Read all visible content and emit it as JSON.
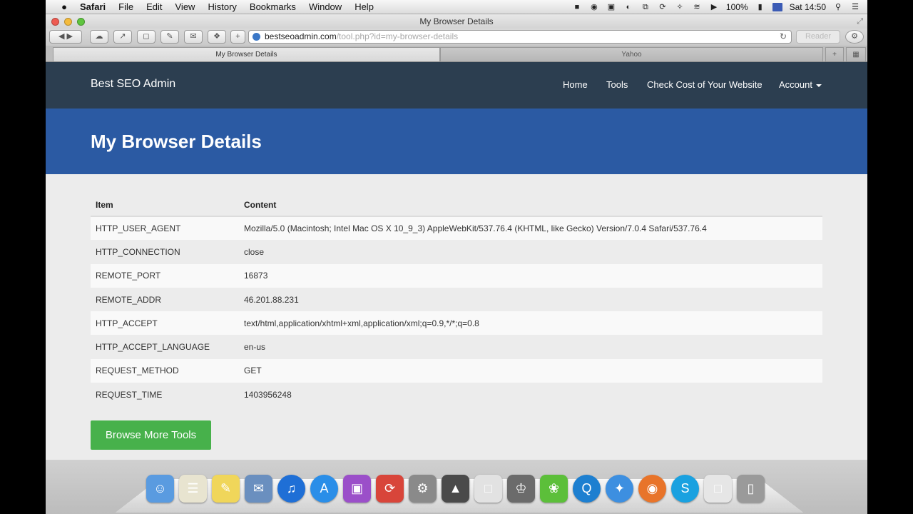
{
  "menubar": {
    "app": "Safari",
    "items": [
      "File",
      "Edit",
      "View",
      "History",
      "Bookmarks",
      "Window",
      "Help"
    ],
    "battery": "100%",
    "clock": "Sat 14:50"
  },
  "window": {
    "title": "My Browser Details",
    "url_host": "bestseoadmin.com",
    "url_path": "/tool.php?id=my-browser-details",
    "reader": "Reader",
    "tabs": [
      "My Browser Details",
      "Yahoo"
    ]
  },
  "site": {
    "brand": "Best SEO Admin",
    "nav": [
      "Home",
      "Tools",
      "Check Cost of Your Website",
      "Account"
    ],
    "hero_title": "My Browser Details",
    "table": {
      "headers": [
        "Item",
        "Content"
      ],
      "rows": [
        [
          "HTTP_USER_AGENT",
          "Mozilla/5.0 (Macintosh; Intel Mac OS X 10_9_3) AppleWebKit/537.76.4 (KHTML, like Gecko) Version/7.0.4 Safari/537.76.4"
        ],
        [
          "HTTP_CONNECTION",
          "close"
        ],
        [
          "REMOTE_PORT",
          "16873"
        ],
        [
          "REMOTE_ADDR",
          "46.201.88.231"
        ],
        [
          "HTTP_ACCEPT",
          "text/html,application/xhtml+xml,application/xml;q=0.9,*/*;q=0.8"
        ],
        [
          "HTTP_ACCEPT_LANGUAGE",
          "en-us"
        ],
        [
          "REQUEST_METHOD",
          "GET"
        ],
        [
          "REQUEST_TIME",
          "1403956248"
        ]
      ]
    },
    "button": "Browse More Tools"
  },
  "dock": [
    {
      "name": "finder-icon",
      "color": "#5a9be0"
    },
    {
      "name": "text-edit-icon",
      "color": "#e8e4d0"
    },
    {
      "name": "notes-icon",
      "color": "#f0d65a"
    },
    {
      "name": "mail-icon",
      "color": "#6a8fbf"
    },
    {
      "name": "itunes-icon",
      "color": "#1f6fd6"
    },
    {
      "name": "app-store-icon",
      "color": "#2a8ee8"
    },
    {
      "name": "display-icon",
      "color": "#9b4fc9"
    },
    {
      "name": "cleanmymac-icon",
      "color": "#d8453a"
    },
    {
      "name": "system-preferences-icon",
      "color": "#8a8a8a"
    },
    {
      "name": "lock-icon",
      "color": "#4a4a4a"
    },
    {
      "name": "preview-icon",
      "color": "#e2e2e2"
    },
    {
      "name": "automator-icon",
      "color": "#6b6b6b"
    },
    {
      "name": "leaf-icon",
      "color": "#5cbf3a"
    },
    {
      "name": "quicktime-icon",
      "color": "#1d7fd0"
    },
    {
      "name": "safari-icon",
      "color": "#3d8fe0"
    },
    {
      "name": "firefox-icon",
      "color": "#e8742a"
    },
    {
      "name": "skype-icon",
      "color": "#1aa1e0"
    },
    {
      "name": "document-icon",
      "color": "#e6e6e6"
    },
    {
      "name": "trash-icon",
      "color": "#9a9a9a"
    }
  ]
}
